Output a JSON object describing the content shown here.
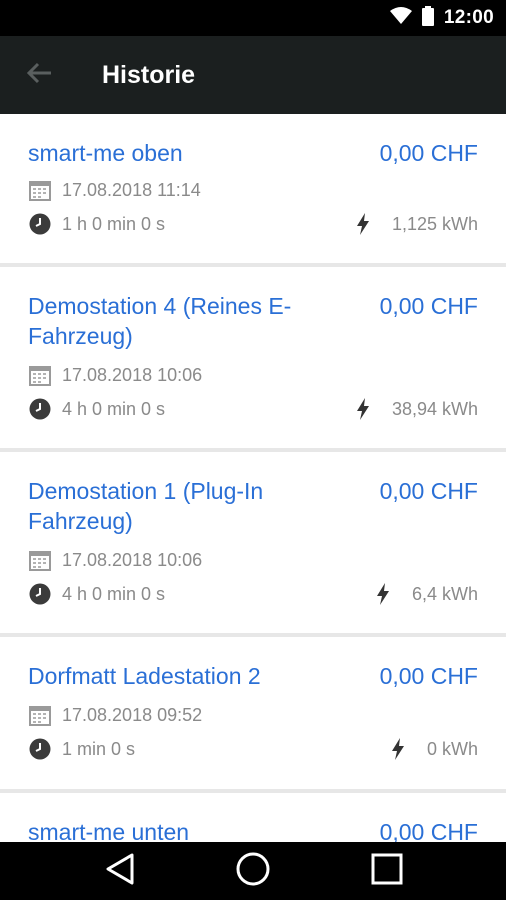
{
  "status_bar": {
    "time": "12:00",
    "icons": [
      "wifi-icon",
      "battery-icon"
    ]
  },
  "app_bar": {
    "back_icon": "arrow-left-icon",
    "title": "Historie"
  },
  "sessions": [
    {
      "name": "smart-me oben",
      "price": "0,00 CHF",
      "date": "17.08.2018 11:14",
      "duration": "1 h 0 min 0 s",
      "energy": "1,125 kWh"
    },
    {
      "name": "Demostation 4 (Reines E-Fahrzeug)",
      "price": "0,00 CHF",
      "date": "17.08.2018 10:06",
      "duration": "4 h 0 min 0 s",
      "energy": "38,94 kWh"
    },
    {
      "name": "Demostation 1 (Plug-In Fahrzeug)",
      "price": "0,00 CHF",
      "date": "17.08.2018 10:06",
      "duration": "4 h 0 min 0 s",
      "energy": "6,4 kWh"
    },
    {
      "name": "Dorfmatt Ladestation 2",
      "price": "0,00 CHF",
      "date": "17.08.2018 09:52",
      "duration": "1 min 0 s",
      "energy": "0 kWh"
    },
    {
      "name": "smart-me unten",
      "price": "0,00 CHF"
    }
  ],
  "colors": {
    "accent": "#2a6fd6",
    "app_bar": "#1b1f1f",
    "meta_text": "#8a8a8a",
    "divider": "#e7e7e7"
  },
  "nav_bar": {
    "icons": [
      "back-triangle-icon",
      "home-circle-icon",
      "recents-square-icon"
    ]
  }
}
